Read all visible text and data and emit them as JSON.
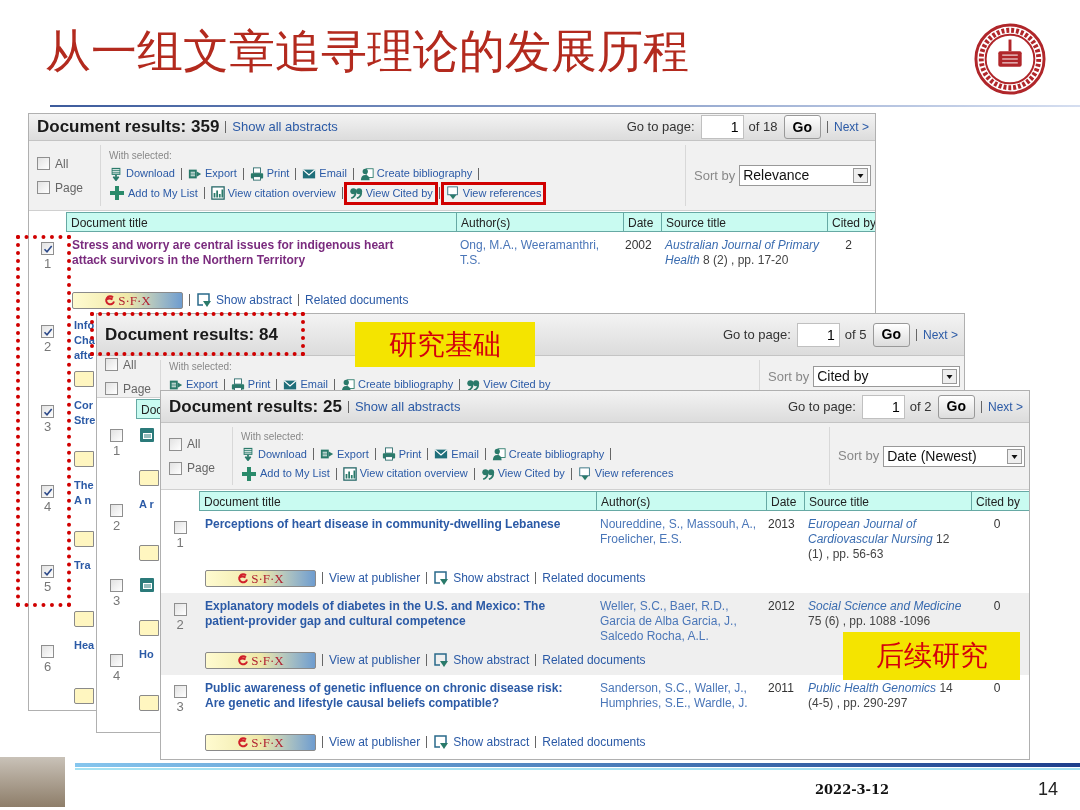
{
  "slide": {
    "title": "从一组文章追寻理论的发展历程",
    "date": "2022-3-12",
    "page_number": "14"
  },
  "panels": [
    {
      "title": "Document results: 359",
      "show_all": "Show all abstracts",
      "pager": {
        "label": "Go to page:",
        "value": "1",
        "total": "of 18",
        "go": "Go",
        "next": "Next >"
      },
      "select": [
        {
          "label": "All",
          "checked": false
        },
        {
          "label": "Page",
          "checked": false
        }
      ],
      "with_selected": "With selected:",
      "actions": [
        [
          {
            "kind": "download",
            "label": "Download"
          },
          {
            "kind": "export",
            "label": "Export"
          },
          {
            "kind": "print",
            "label": "Print"
          },
          {
            "kind": "email",
            "label": "Email"
          },
          {
            "kind": "bibliography",
            "label": "Create bibliography"
          }
        ],
        [
          {
            "kind": "add",
            "label": "Add to My List"
          },
          {
            "kind": "overview",
            "label": "View citation overview"
          },
          {
            "kind": "cited",
            "label": "View Cited by"
          },
          {
            "kind": "references",
            "label": "View references"
          }
        ]
      ],
      "sort": {
        "label": "Sort by",
        "value": "Relevance"
      },
      "columns": [
        "Document title",
        "Author(s)",
        "Date",
        "Source title",
        "Cited by"
      ],
      "rows": [
        {
          "kind": "full",
          "number": "1",
          "checked": true,
          "visited": true,
          "title": "Stress and worry are central issues for indigenous heart attack survivors in the Northern Territory",
          "authors": "Ong, M.A., Weeramanthri, T.S.",
          "date": "2002",
          "source": "*Australian Journal of Primary Health* 8 (2) , pp. 17-20",
          "cited_by": "2",
          "links": [
            {
              "kind": "sfx",
              "label": "S·F·X"
            },
            {
              "kind": "abstract",
              "label": "Show abstract"
            },
            {
              "kind": "link",
              "label": "Related documents"
            }
          ]
        },
        {
          "kind": "stub",
          "number": "2",
          "checked": true,
          "fragments": [
            "Info",
            "Cha",
            "afte"
          ]
        },
        {
          "kind": "stub",
          "number": "3",
          "checked": true,
          "fragments": [
            "Cor",
            "Stre"
          ]
        },
        {
          "kind": "stub",
          "number": "4",
          "checked": true,
          "fragments": [
            "The",
            "A n"
          ]
        },
        {
          "kind": "stub",
          "number": "5",
          "checked": true,
          "fragments": [
            "Tra"
          ]
        },
        {
          "kind": "stub",
          "number": "6",
          "checked": false,
          "fragments": [
            "Hea"
          ]
        }
      ]
    },
    {
      "title": "Document results: 84",
      "pager": {
        "label": "Go to page:",
        "value": "1",
        "total": "of 5",
        "go": "Go",
        "next": "Next >"
      },
      "select": [
        {
          "label": "All",
          "checked": false
        },
        {
          "label": "Page",
          "checked": false
        }
      ],
      "with_selected": "With selected:",
      "actions": [
        [
          {
            "kind": "export",
            "label": "Export"
          },
          {
            "kind": "print",
            "label": "Print"
          },
          {
            "kind": "email",
            "label": "Email"
          },
          {
            "kind": "bibliography",
            "label": "Create bibliography"
          },
          {
            "kind": "cited",
            "label": "View Cited by"
          }
        ]
      ],
      "sort": {
        "label": "Sort by",
        "value": "Cited by"
      },
      "columns": [
        "Doc"
      ],
      "rows": [
        {
          "kind": "stub_icon",
          "number": "1",
          "checked": false
        },
        {
          "kind": "stub",
          "number": "2",
          "checked": false,
          "fragments": [
            "A r"
          ]
        },
        {
          "kind": "stub_icon",
          "number": "3",
          "checked": false
        },
        {
          "kind": "stub",
          "number": "4",
          "checked": false,
          "fragments": [
            "Ho"
          ]
        }
      ]
    },
    {
      "title": "Document results: 25",
      "show_all": "Show all abstracts",
      "pager": {
        "label": "Go to page:",
        "value": "1",
        "total": "of 2",
        "go": "Go",
        "next": "Next >"
      },
      "select": [
        {
          "label": "All",
          "checked": false
        },
        {
          "label": "Page",
          "checked": false
        }
      ],
      "with_selected": "With selected:",
      "actions": [
        [
          {
            "kind": "download",
            "label": "Download"
          },
          {
            "kind": "export",
            "label": "Export"
          },
          {
            "kind": "print",
            "label": "Print"
          },
          {
            "kind": "email",
            "label": "Email"
          },
          {
            "kind": "bibliography",
            "label": "Create bibliography"
          }
        ],
        [
          {
            "kind": "add",
            "label": "Add to My List"
          },
          {
            "kind": "overview",
            "label": "View citation overview"
          },
          {
            "kind": "cited",
            "label": "View Cited by"
          },
          {
            "kind": "references",
            "label": "View references"
          }
        ]
      ],
      "sort": {
        "label": "Sort by",
        "value": "Date (Newest)"
      },
      "columns": [
        "Document title",
        "Author(s)",
        "Date",
        "Source title",
        "Cited by"
      ],
      "rows": [
        {
          "kind": "full",
          "number": "1",
          "checked": false,
          "visited": false,
          "title": "Perceptions of heart disease in community-dwelling Lebanese",
          "authors": "Noureddine, S., Massouh, A., Froelicher, E.S.",
          "date": "2013",
          "source": "*European Journal of Cardiovascular Nursing* 12 (1) , pp. 56-63",
          "cited_by": "0",
          "links": [
            {
              "kind": "sfx",
              "label": "S·F·X"
            },
            {
              "kind": "link",
              "label": "View at publisher"
            },
            {
              "kind": "abstract",
              "label": "Show abstract"
            },
            {
              "kind": "link",
              "label": "Related documents"
            }
          ]
        },
        {
          "kind": "full",
          "number": "2",
          "checked": false,
          "visited": false,
          "title": "Explanatory models of diabetes in the U.S. and Mexico: The patient-provider gap and cultural competence",
          "authors": "Weller, S.C., Baer, R.D., Garcia de Alba Garcia, J., Salcedo Rocha, A.L.",
          "date": "2012",
          "source": "*Social Science and Medicine* 75 (6) , pp. 1088 -1096",
          "cited_by": "0",
          "links": [
            {
              "kind": "sfx",
              "label": "S·F·X"
            },
            {
              "kind": "link",
              "label": "View at publisher"
            },
            {
              "kind": "abstract",
              "label": "Show abstract"
            },
            {
              "kind": "link",
              "label": "Related documents"
            }
          ]
        },
        {
          "kind": "full",
          "number": "3",
          "checked": false,
          "visited": false,
          "title": "Public awareness of genetic influence on chronic disease risk: Are genetic and lifestyle causal beliefs compatible?",
          "authors": "Sanderson, S.C., Waller, J., Humphries, S.E., Wardle, J.",
          "date": "2011",
          "source": "*Public Health Genomics* 14 (4-5) , pp. 290-297",
          "cited_by": "0",
          "links": [
            {
              "kind": "sfx",
              "label": "S·F·X"
            },
            {
              "kind": "link",
              "label": "View at publisher"
            },
            {
              "kind": "abstract",
              "label": "Show abstract"
            },
            {
              "kind": "link",
              "label": "Related documents"
            }
          ]
        }
      ]
    }
  ],
  "callouts": [
    {
      "text": "研究基础"
    },
    {
      "text": "后续研究"
    }
  ]
}
